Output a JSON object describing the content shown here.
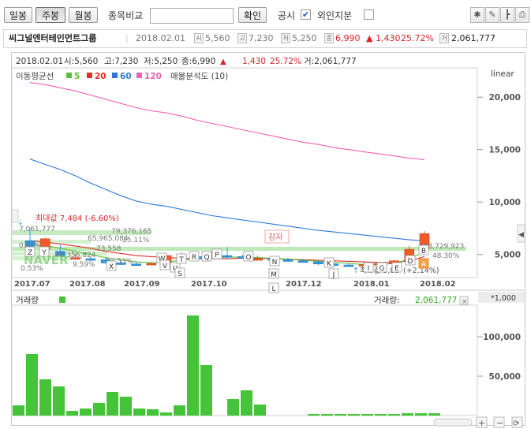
{
  "toolbar": {
    "daily": "일봉",
    "weekly": "주봉",
    "monthly": "월봉",
    "compare_label": "종목비교",
    "compare_value": "",
    "confirm": "확인",
    "disclosure": "공시",
    "disclosure_checked": "✔",
    "foreign": "외인지분",
    "foreign_checked": ""
  },
  "infobar": {
    "name": "씨그널엔터테인먼트그룹",
    "date": "2018.02.01",
    "open_badge": "시",
    "open": "5,560",
    "high_badge": "고",
    "high": "7,230",
    "low_badge": "저",
    "low": "5,250",
    "close_badge": "종",
    "close": "6,990",
    "change": "▲ 1,430",
    "change_pct": "25.72%",
    "volume_badge": "거",
    "volume": "2,061,777"
  },
  "ohlc_line": {
    "date": "2018.02.01",
    "open": "시:5,560",
    "high": "고:7,230",
    "low": "저:5,250",
    "close": "종:6,990",
    "arrow": "▲",
    "change": "1,430",
    "pct": "25.72%",
    "volume": "거:2,061,777"
  },
  "legend": {
    "ma_title": "이동평균선",
    "ma5": "5",
    "ma20": "20",
    "ma60": "60",
    "ma120": "120",
    "profile": "매물분석도 (10)",
    "scale": "linear"
  },
  "colors": {
    "ma5": "#5bbf3a",
    "ma20": "#e0312a",
    "ma60": "#2f78d6",
    "ma120": "#f05fb6",
    "up": "#f2592a",
    "down": "#3398e0",
    "volume": "#46c439",
    "positive": "#d8252a",
    "green_text": "#2ea824"
  },
  "annotations": {
    "max": "최대값 7,484 (-6.60%)",
    "min": "최소값 3,85",
    "min_pct": "(+2.14%)",
    "gamja": "감자",
    "vp_top": "7,061,777",
    "vp_top_pct": "0.00%",
    "vp_1": "79,376,165",
    "vp_1_pct": "15.11%",
    "vp_2": "65,965,084",
    "vp_3": "73,558",
    "vp_4": "40,356,824",
    "vp_4_pct": "9.59%",
    "vp_5": "13.53%",
    "vp_6": "0.53%",
    "vp_7": "283,729,923",
    "vp_7_pct": "48.30%",
    "watermark": "NAVER"
  },
  "event_letters": [
    "Z",
    "Y",
    "X",
    "W",
    "V",
    "U",
    "T",
    "S",
    "R",
    "Q",
    "P",
    "O",
    "N",
    "M",
    "L",
    "K",
    "J",
    "I",
    "G",
    "E",
    "D",
    "B",
    "A"
  ],
  "volume_panel": {
    "title": "거래량",
    "value_label": "거래량:",
    "value": "2,061,777",
    "close_icon": "×",
    "unit": "*1,000"
  },
  "chart_data": [
    {
      "type": "candlestick",
      "title": "씨그널엔터테인먼트그룹",
      "x_ticks": [
        "2017.07",
        "2017.08",
        "2017.09",
        "2017.10",
        "2017.12",
        "2018.01",
        "2018.02"
      ],
      "y_ticks": [
        5000,
        10000,
        15000,
        20000
      ],
      "ylim": [
        2800,
        22800
      ],
      "scale": "linear",
      "candles": [
        {
          "o": 6300,
          "h": 7484,
          "l": 5500,
          "c": 5600
        },
        {
          "o": 5500,
          "h": 6600,
          "l": 5300,
          "c": 6500
        },
        {
          "o": 5300,
          "h": 5900,
          "l": 4800,
          "c": 4900
        },
        {
          "o": 4700,
          "h": 5000,
          "l": 4600,
          "c": 4700
        },
        {
          "o": 4600,
          "h": 4800,
          "l": 4400,
          "c": 4500
        },
        {
          "o": 4500,
          "h": 4700,
          "l": 4100,
          "c": 4200
        },
        {
          "o": 4200,
          "h": 4500,
          "l": 4000,
          "c": 4100
        },
        {
          "o": 4100,
          "h": 4300,
          "l": 3900,
          "c": 4000
        },
        {
          "o": 4100,
          "h": 4300,
          "l": 4000,
          "c": 4150
        },
        {
          "o": 4100,
          "h": 5000,
          "l": 4000,
          "c": 4900
        },
        {
          "o": 4900,
          "h": 5200,
          "l": 4700,
          "c": 4800
        },
        {
          "o": 4800,
          "h": 5000,
          "l": 4500,
          "c": 4600
        },
        {
          "o": 4700,
          "h": 5300,
          "l": 4700,
          "c": 5100
        },
        {
          "o": 4900,
          "h": 5700,
          "l": 4500,
          "c": 4800
        },
        {
          "o": 4800,
          "h": 5000,
          "l": 4600,
          "c": 4700
        },
        {
          "o": 4600,
          "h": 4900,
          "l": 4500,
          "c": 4600
        },
        {
          "o": 4600,
          "h": 4800,
          "l": 4400,
          "c": 4500
        },
        {
          "o": 4500,
          "h": 4700,
          "l": 4300,
          "c": 4400
        },
        {
          "o": 4400,
          "h": 4600,
          "l": 4200,
          "c": 4300
        },
        {
          "o": 4300,
          "h": 4500,
          "l": 4000,
          "c": 4100
        },
        {
          "o": 4100,
          "h": 4300,
          "l": 3900,
          "c": 4000
        },
        {
          "o": 4000,
          "h": 4200,
          "l": 3850,
          "c": 3950
        },
        {
          "o": 3950,
          "h": 4200,
          "l": 3900,
          "c": 4050
        },
        {
          "o": 4050,
          "h": 4300,
          "l": 3950,
          "c": 4150
        },
        {
          "o": 4100,
          "h": 4500,
          "l": 4000,
          "c": 4400
        },
        {
          "o": 4300,
          "h": 5800,
          "l": 4200,
          "c": 5500
        },
        {
          "o": 5560,
          "h": 7230,
          "l": 5250,
          "c": 6990
        }
      ],
      "series": [
        {
          "name": "120",
          "values": [
            21400,
            21200,
            20900,
            20600,
            20200,
            19800,
            19400,
            19000,
            18700,
            18500,
            18200,
            17800,
            17500,
            17200,
            16900,
            16600,
            16300,
            16000,
            15700,
            15500,
            15200,
            15000,
            14800,
            14600,
            14400,
            14200,
            14050
          ]
        },
        {
          "name": "60",
          "values": [
            14100,
            13600,
            13100,
            12500,
            11800,
            11200,
            10600,
            10100,
            9800,
            9600,
            9300,
            9000,
            8700,
            8500,
            8300,
            8100,
            7900,
            7700,
            7500,
            7300,
            7150,
            7000,
            6850,
            6700,
            6550,
            6400,
            6300
          ]
        },
        {
          "name": "20",
          "values": [
            6300,
            6200,
            6000,
            5800,
            5600,
            5300,
            5100,
            4900,
            4800,
            4700,
            4650,
            4600,
            4600,
            4600,
            4650,
            4650,
            4600,
            4550,
            4500,
            4450,
            4400,
            4350,
            4300,
            4250,
            4250,
            4400,
            4800
          ]
        },
        {
          "name": "5",
          "values": [
            5900,
            5850,
            5600,
            5300,
            5000,
            4700,
            4500,
            4300,
            4200,
            4300,
            4450,
            4600,
            4700,
            4750,
            4750,
            4700,
            4650,
            4550,
            4450,
            4350,
            4250,
            4150,
            4050,
            4050,
            4150,
            4550,
            5300
          ]
        }
      ]
    },
    {
      "type": "bar",
      "title": "거래량",
      "ylabel": "*1,000",
      "y_ticks": [
        50000,
        100000
      ],
      "ylim": [
        0,
        140000
      ],
      "values": [
        13000,
        78000,
        46000,
        37000,
        6000,
        9000,
        16000,
        30000,
        24000,
        9000,
        8000,
        4000,
        13000,
        127000,
        64000,
        0,
        21000,
        32000,
        14000,
        0,
        0,
        0,
        2000,
        2000,
        2000,
        2000,
        2000,
        2000,
        2000,
        3000,
        3000,
        3000
      ]
    }
  ]
}
